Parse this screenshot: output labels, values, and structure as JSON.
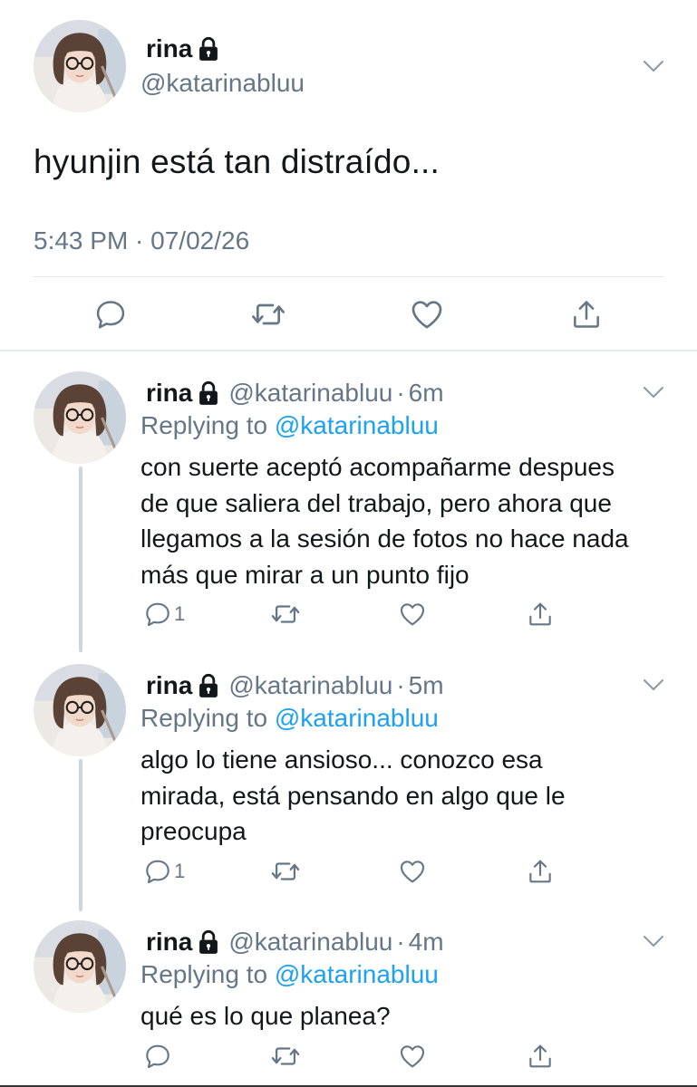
{
  "main_tweet": {
    "name": "rina",
    "handle": "@katarinabluu",
    "text": "hyunjin está tan distraído...",
    "meta": "5:43 PM · 07/02/26"
  },
  "replies": [
    {
      "name": "rina",
      "handle": "@katarinabluu",
      "time": "6m",
      "replying_prefix": "Replying to",
      "replying_to": "@katarinabluu",
      "text_lines": [
        "con suerte aceptó acompañarme despues",
        "de que saliera del trabajo, pero ahora que",
        "llegamos a la sesión de fotos no hace nada",
        "más que mirar a un punto fijo"
      ],
      "reply_count": "1"
    },
    {
      "name": "rina",
      "handle": "@katarinabluu",
      "time": "5m",
      "replying_prefix": "Replying to",
      "replying_to": "@katarinabluu",
      "text_lines": [
        "algo lo tiene ansioso... conozco esa",
        "mirada, está pensando en algo que le",
        "preocupa"
      ],
      "reply_count": "1"
    },
    {
      "name": "rina",
      "handle": "@katarinabluu",
      "time": "4m",
      "replying_prefix": "Replying to",
      "replying_to": "@katarinabluu",
      "text_lines": [
        "qué es lo que planea?"
      ],
      "reply_count": ""
    }
  ],
  "icons": {
    "reply": "comment-bubble-icon",
    "retweet": "retweet-icon",
    "like": "heart-icon",
    "share": "share-icon",
    "more": "chevron-down-icon",
    "protected": "lock-icon"
  },
  "colors": {
    "link": "#1da1f2",
    "secondary_text": "#657786",
    "icon": "#657786"
  }
}
